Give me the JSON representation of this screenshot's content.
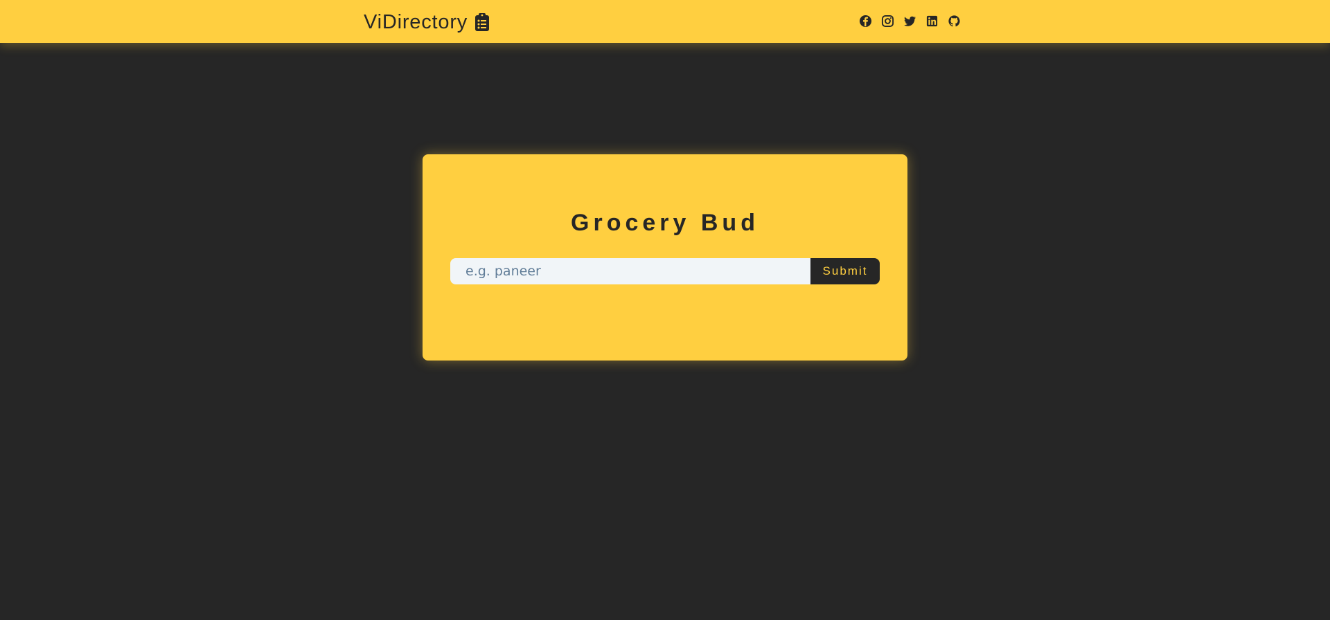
{
  "navbar": {
    "brand": "ViDirectory",
    "brand_icon": "clipboard-list-icon",
    "social_icons": [
      "facebook-icon",
      "instagram-icon",
      "twitter-icon",
      "linkedin-icon",
      "github-icon"
    ]
  },
  "card": {
    "title": "Grocery Bud",
    "input_placeholder": "e.g. paneer",
    "input_value": "",
    "submit_label": "Submit"
  },
  "colors": {
    "background": "#262626",
    "accent": "#ffcf40",
    "input_background": "#f1f5f8",
    "placeholder": "#617d98"
  }
}
